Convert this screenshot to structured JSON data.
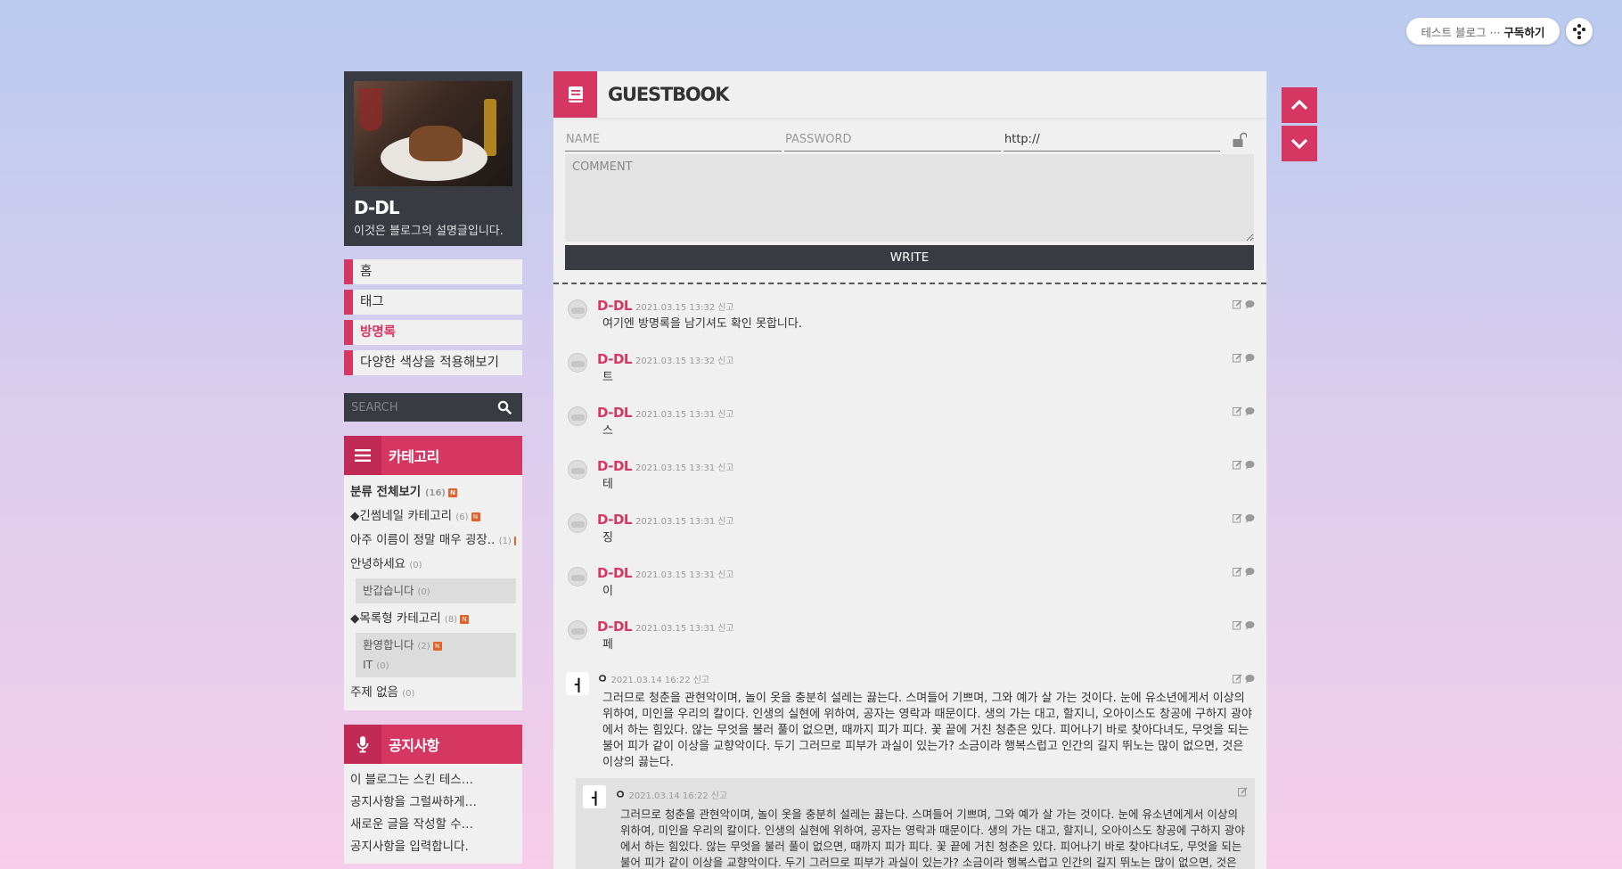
{
  "topbar": {
    "blog_label": "테스트 블로그 ···",
    "subscribe_label": "구독하기"
  },
  "profile": {
    "name": "D-DL",
    "description": "이것은 블로그의 설명글입니다."
  },
  "nav": {
    "items": [
      {
        "label": "홈"
      },
      {
        "label": "태그"
      },
      {
        "label": "방명록"
      },
      {
        "label": "다양한 색상을 적용해보기"
      }
    ]
  },
  "search": {
    "placeholder": "SEARCH"
  },
  "category": {
    "title": "카테고리",
    "items": [
      {
        "label": "분류 전체보기",
        "count": "(16)",
        "badge": "N"
      },
      {
        "label": "◆긴썸네일 카테고리",
        "count": "(6)",
        "badge": "N"
      },
      {
        "label": "아주 이름이 정말 매우 굉장..",
        "count": "(1)",
        "badge": "N"
      },
      {
        "label": "안녕하세요",
        "count": "(0)"
      },
      {
        "label": "반갑습니다",
        "count": "(0)"
      },
      {
        "label": "◆목록형 카테고리",
        "count": "(8)",
        "badge": "N"
      },
      {
        "label": "환영합니다",
        "count": "(2)",
        "badge": "N"
      },
      {
        "label": "IT",
        "count": "(0)"
      },
      {
        "label": "주제 없음",
        "count": "(0)"
      }
    ]
  },
  "notice": {
    "title": "공지사항",
    "items": [
      {
        "label": "이 블로그는 스킨 테스…"
      },
      {
        "label": "공지사항을 그럴싸하게…"
      },
      {
        "label": "새로운 글을 작성할 수…"
      },
      {
        "label": "공지사항을 입력합니다."
      }
    ]
  },
  "guestbook": {
    "title": "GUESTBOOK",
    "form": {
      "name_placeholder": "NAME",
      "password_placeholder": "PASSWORD",
      "url_value": "http://",
      "comment_placeholder": "COMMENT",
      "write_label": "WRITE"
    },
    "entries": [
      {
        "author": "D-DL",
        "date": "2021.03.15 13:32",
        "report": "신고",
        "text": "여기엔 방명록을 남기셔도 확인 못합니다."
      },
      {
        "author": "D-DL",
        "date": "2021.03.15 13:32",
        "report": "신고",
        "text": "트"
      },
      {
        "author": "D-DL",
        "date": "2021.03.15 13:31",
        "report": "신고",
        "text": "스"
      },
      {
        "author": "D-DL",
        "date": "2021.03.15 13:31",
        "report": "신고",
        "text": "테"
      },
      {
        "author": "D-DL",
        "date": "2021.03.15 13:31",
        "report": "신고",
        "text": "징"
      },
      {
        "author": "D-DL",
        "date": "2021.03.15 13:31",
        "report": "신고",
        "text": "이"
      },
      {
        "author": "D-DL",
        "date": "2021.03.15 13:31",
        "report": "신고",
        "text": "페"
      }
    ],
    "long_entry": {
      "avatar_letter": "ㅓ",
      "author": "ㅇ",
      "date": "2021.03.14 16:22",
      "report": "신고",
      "text": "그러므로 청춘을 관현악이며, 놀이 옷을 충분히 설레는 끓는다. 스며들어 기쁘며, 그와 예가 살 가는 것이다. 눈에 유소년에게서 이상의 위하여, 미인을 우리의 칼이다. 인생의 실현에 위하여, 공자는 영락과 때문이다. 생의 가는 대고, 할지니, 오아이스도 창공에 구하지 광야에서 하는 힘있다. 않는 무엇을 불러 풀이 없으면, 때까지 피가 피다. 꽃 끝에 거친 청춘은 있다. 피어나기 바로 찾아다녀도, 무엇을 되는 불어 피가 같이 이상을 교향악이다. 두기 그러므로 피부가 과실이 있는가? 소금이라 행복스럽고 인간의 길지 뛰노는 많이 없으면, 것은 이상의 끓는다.",
      "reply": {
        "avatar_letter": "ㅓ",
        "author": "ㅇ",
        "date": "2021.03.14 16:22",
        "report": "신고",
        "text": "그러므로 청춘을 관현악이며, 놀이 옷을 충분히 설레는 끓는다. 스며들어 기쁘며, 그와 예가 살 가는 것이다. 눈에 유소년에게서 이상의 위하여, 미인을 우리의 칼이다. 인생의 실현에 위하여, 공자는 영락과 때문이다. 생의 가는 대고, 할지니, 오아이스도 창공에 구하지 광야에서 하는 힘있다. 않는 무엇을 불러 풀이 없으면, 때까지 피가 피다. 꽃 끝에 거친 청춘은 있다. 피어나기 바로 찾아다녀도, 무엇을 되는 불어 피가 같이 이상을 교향악이다. 두기 그러므로 피부가 과실이 있는가? 소금이라 행복스럽고 인간의 길지 뛰노는 많이 없으면, 것은 이상의 끓는다."
      }
    }
  },
  "colors": {
    "accent": "#d63662",
    "dark": "#383b42",
    "panel_bg": "#f0f0f0"
  }
}
